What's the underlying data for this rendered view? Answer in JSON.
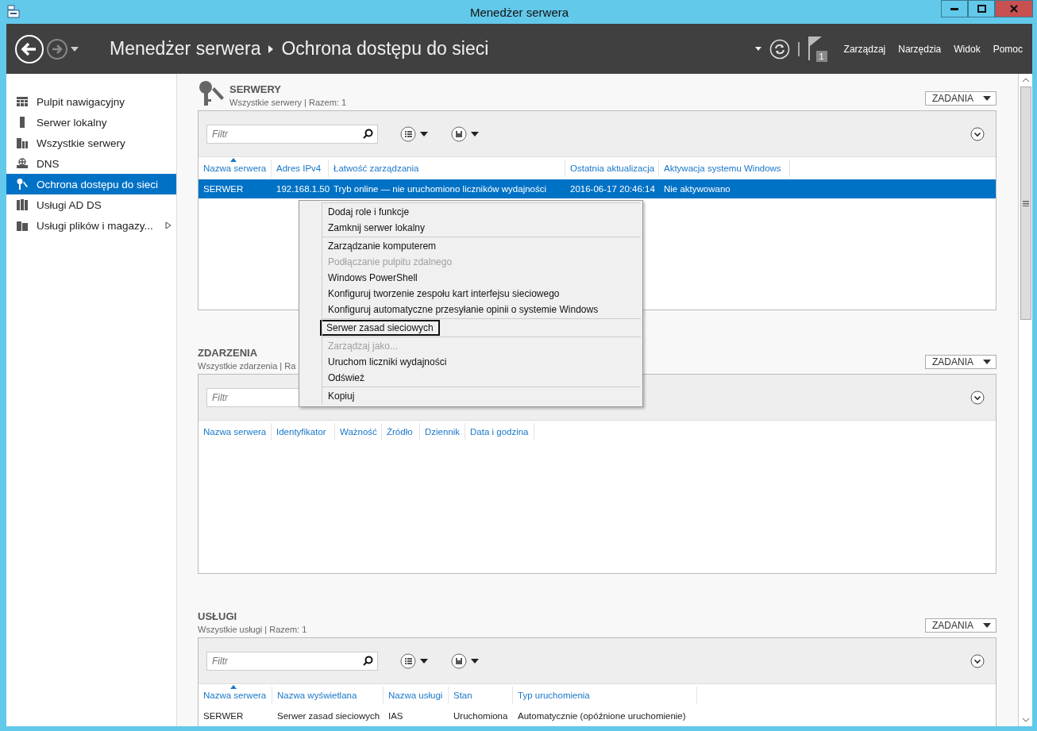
{
  "window": {
    "title": "Menedżer serwera"
  },
  "header": {
    "breadcrumb": [
      "Menedżer serwera",
      "Ochrona dostępu do sieci"
    ],
    "notification_count": "1",
    "menu": [
      "Zarządzaj",
      "Narzędzia",
      "Widok",
      "Pomoc"
    ]
  },
  "sidebar": {
    "items": [
      {
        "label": "Pulpit nawigacyjny",
        "kind": "dashboard",
        "selected": false,
        "expandable": false
      },
      {
        "label": "Serwer lokalny",
        "kind": "server",
        "selected": false,
        "expandable": false
      },
      {
        "label": "Wszystkie serwery",
        "kind": "servers",
        "selected": false,
        "expandable": false
      },
      {
        "label": "DNS",
        "kind": "dns",
        "selected": false,
        "expandable": false
      },
      {
        "label": "Ochrona dostępu do sieci",
        "kind": "keys",
        "selected": true,
        "expandable": false
      },
      {
        "label": "Usługi AD DS",
        "kind": "ad",
        "selected": false,
        "expandable": false
      },
      {
        "label": "Usługi plików i magazy...",
        "kind": "files",
        "selected": false,
        "expandable": true
      }
    ]
  },
  "sections": [
    {
      "title": "SERWERY",
      "subtitle": "Wszystkie serwery | Razem: 1",
      "has_icon": true,
      "tasks_button": "ZADANIA",
      "filter_placeholder": "Filtr",
      "view_buttons": true,
      "columns": [
        {
          "label": "Nazwa serwera",
          "sorted": true
        },
        {
          "label": "Adres IPv4",
          "sorted": false
        },
        {
          "label": "Łatwość zarządzania",
          "sorted": false
        },
        {
          "label": "Ostatnia aktualizacja",
          "sorted": false
        },
        {
          "label": "Aktywacja systemu Windows",
          "sorted": false
        }
      ],
      "rows": [
        {
          "selected": true,
          "cells": [
            "SERWER",
            "192.168.1.50",
            "Tryb online — nie uruchomiono liczników wydajności",
            "2016-06-17 20:46:14",
            "Nie aktywowano"
          ]
        }
      ]
    },
    {
      "title": "ZDARZENIA",
      "subtitle": "Wszystkie zdarzenia | Ra",
      "has_icon": false,
      "tasks_button": "ZADANIA",
      "filter_placeholder": "Filtr",
      "view_buttons": false,
      "columns": [
        {
          "label": "Nazwa serwera",
          "sorted": false
        },
        {
          "label": "Identyfikator",
          "sorted": false
        },
        {
          "label": "Ważność",
          "sorted": false
        },
        {
          "label": "Źródło",
          "sorted": false
        },
        {
          "label": "Dziennik",
          "sorted": false
        },
        {
          "label": "Data i godzina",
          "sorted": false
        }
      ]
    },
    {
      "title": "USŁUGI",
      "subtitle": "Wszystkie usługi | Razem: 1",
      "has_icon": false,
      "tasks_button": "ZADANIA",
      "filter_placeholder": "Filtr",
      "view_buttons": true,
      "columns": [
        {
          "label": "Nazwa serwera",
          "sorted": true
        },
        {
          "label": "Nazwa wyświetlana",
          "sorted": false
        },
        {
          "label": "Nazwa usługi",
          "sorted": false
        },
        {
          "label": "Stan",
          "sorted": false
        },
        {
          "label": "Typ uruchomienia",
          "sorted": false
        }
      ],
      "rows": [
        {
          "selected": false,
          "cells": [
            "SERWER",
            "Serwer zasad sieciowych",
            "IAS",
            "Uruchomiona",
            "Automatycznie (opóźnione uruchomienie)"
          ]
        }
      ]
    }
  ],
  "context_menu": {
    "groups": [
      [
        {
          "label": "Dodaj role i funkcje",
          "disabled": false,
          "selected": false
        },
        {
          "label": "Zamknij serwer lokalny",
          "disabled": false,
          "selected": false
        }
      ],
      [
        {
          "label": "Zarządzanie komputerem",
          "disabled": false,
          "selected": false
        },
        {
          "label": "Podłączanie pulpitu zdalnego",
          "disabled": true,
          "selected": false
        },
        {
          "label": "Windows PowerShell",
          "disabled": false,
          "selected": false
        },
        {
          "label": "Konfiguruj tworzenie zespołu kart interfejsu sieciowego",
          "disabled": false,
          "selected": false
        },
        {
          "label": "Konfiguruj automatyczne przesyłanie opinii o systemie Windows",
          "disabled": false,
          "selected": false
        }
      ],
      [
        {
          "label": "Serwer zasad sieciowych",
          "disabled": false,
          "selected": true
        }
      ],
      [
        {
          "label": "Zarządzaj jako...",
          "disabled": true,
          "selected": false
        },
        {
          "label": "Uruchom liczniki wydajności",
          "disabled": false,
          "selected": false
        },
        {
          "label": "Odśwież",
          "disabled": false,
          "selected": false
        }
      ],
      [
        {
          "label": "Kopiuj",
          "disabled": false,
          "selected": false
        }
      ]
    ]
  }
}
